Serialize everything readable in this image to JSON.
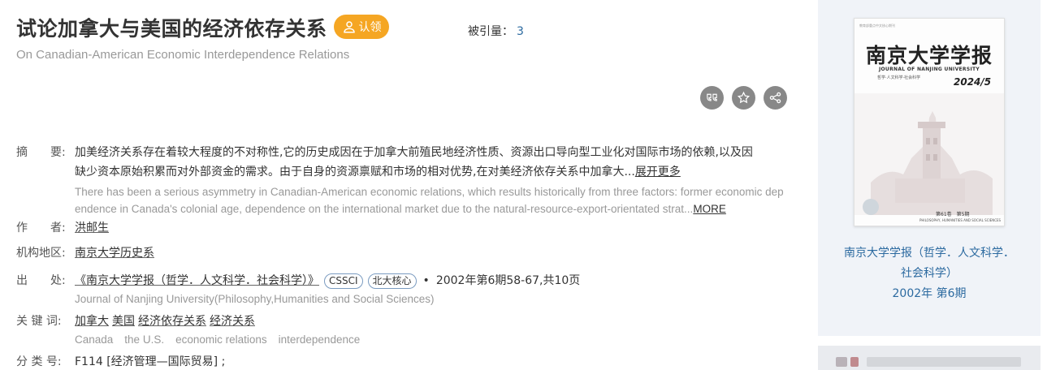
{
  "header": {
    "title": "试论加拿大与美国的经济依存关系",
    "claim_label": "认领",
    "cited_label": "被引量：",
    "cited_count": "3",
    "en_title": "On Canadian-American Economic Interdependence Relations"
  },
  "actions": [
    "quote-icon",
    "star-icon",
    "share-icon"
  ],
  "fields": {
    "abstract_label": "摘　　要:",
    "abstract_zh_line1": "加美经济关系存在着较大程度的不对称性,它的历史成因在于加拿大前殖民地经济性质、资源出口导向型工业化对国际市场的依赖,以及因",
    "abstract_zh_line2": "缺少资本原始积累而对外部资金的需求。由于自身的资源禀赋和市场的相对优势,在对美经济依存关系中加拿大...",
    "abstract_zh_more": "展开更多",
    "abstract_en_line1": "There has been a serious asymmetry in Canadian-American economic relations, which results historically from three factors: former economic dep",
    "abstract_en_line2": "endence in Canada's colonial age, dependence on the international market due to the natural-resource-export-orientated strat...",
    "abstract_en_more": "MORE",
    "author_label": "作　　者:",
    "author": "洪邮生",
    "org_label": "机构地区:",
    "org": "南京大学历史系",
    "source_label": "出　　处:",
    "source_journal": "《南京大学学报（哲学．人文科学．社会科学）》",
    "source_tags": [
      "CSSCI",
      "北大核心"
    ],
    "source_dot": "•",
    "source_detail": "2002年第6期58-67,共10页",
    "source_en": "Journal of Nanjing University(Philosophy,Humanities and Social Sciences)",
    "keywords_label": "关 键 词:",
    "keywords": [
      "加拿大",
      "美国",
      "经济依存关系",
      "经济关系"
    ],
    "keywords_en": [
      "Canada",
      "the U.S.",
      "economic relations",
      "interdependence"
    ],
    "class_label": "分 类 号:",
    "class_value": "F114 [经济管理—国际贸易] ;"
  },
  "sidebar": {
    "cover_top_text": "教育部重点中文核心期刊",
    "cover_title": "南京大学学报",
    "cover_en": "JOURNAL OF NANJING UNIVERSITY",
    "cover_sub": "哲学·人文科学·社会科学",
    "cover_issue": "2024/5",
    "cover_volume": "第61卷　第5期",
    "cover_bottom_en": "PHILOSOPHY, HUMANITIES AND SOCIAL SCIENCES",
    "journal_line1": "南京大学学报（哲学．人文科学．社会科学）",
    "journal_line2": "2002年 第6期"
  },
  "colors": {
    "badge": "#f5a623",
    "link_blue": "#2c6aa0",
    "icon_gray": "#888888",
    "sidebar_bg": "#f0f3f8"
  }
}
